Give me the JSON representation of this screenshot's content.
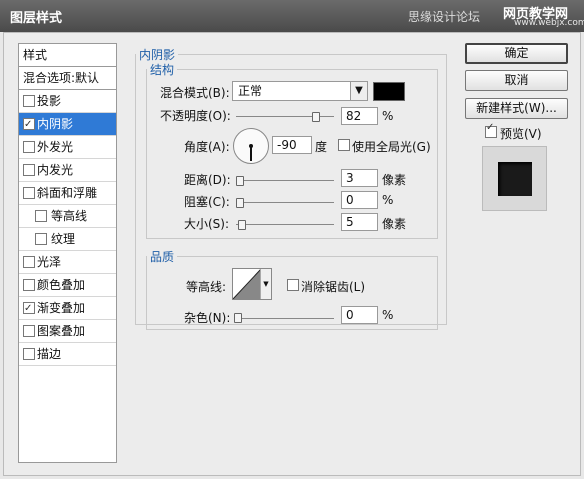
{
  "window": {
    "title": "图层样式"
  },
  "watermark": {
    "text1": "思缘设计论坛",
    "text2": "网页教学网",
    "text3": "www.webjx.com"
  },
  "sidebar": {
    "header": "样式",
    "blend_label": "混合选项:默认",
    "items": [
      {
        "label": "投影",
        "checked": false
      },
      {
        "label": "内阴影",
        "checked": true,
        "selected": true
      },
      {
        "label": "外发光",
        "checked": false
      },
      {
        "label": "内发光",
        "checked": false
      },
      {
        "label": "斜面和浮雕",
        "checked": false
      },
      {
        "label": "等高线",
        "checked": false,
        "indent": true
      },
      {
        "label": "纹理",
        "checked": false,
        "indent": true
      },
      {
        "label": "光泽",
        "checked": false
      },
      {
        "label": "颜色叠加",
        "checked": false
      },
      {
        "label": "渐变叠加",
        "checked": true
      },
      {
        "label": "图案叠加",
        "checked": false
      },
      {
        "label": "描边",
        "checked": false
      }
    ]
  },
  "inner_shadow": {
    "group_title": "内阴影",
    "structure": {
      "title": "结构",
      "blend_mode_label": "混合模式(B):",
      "blend_mode_value": "正常",
      "shadow_color": "#000000",
      "opacity_label": "不透明度(O):",
      "opacity_value": "82",
      "opacity_unit": "%",
      "angle_label": "角度(A):",
      "angle_value": "-90",
      "angle_unit": "度",
      "global_light_label": "使用全局光(G)",
      "global_light_checked": false,
      "distance_label": "距离(D):",
      "distance_value": "3",
      "distance_unit": "像素",
      "choke_label": "阻塞(C):",
      "choke_value": "0",
      "choke_unit": "%",
      "size_label": "大小(S):",
      "size_value": "5",
      "size_unit": "像素"
    },
    "quality": {
      "title": "品质",
      "contour_label": "等高线:",
      "antialias_label": "消除锯齿(L)",
      "antialias_checked": false,
      "noise_label": "杂色(N):",
      "noise_value": "0",
      "noise_unit": "%"
    }
  },
  "buttons": {
    "ok": "确定",
    "cancel": "取消",
    "new_style": "新建样式(W)...",
    "preview_label": "预览(V)",
    "preview_checked": true
  }
}
